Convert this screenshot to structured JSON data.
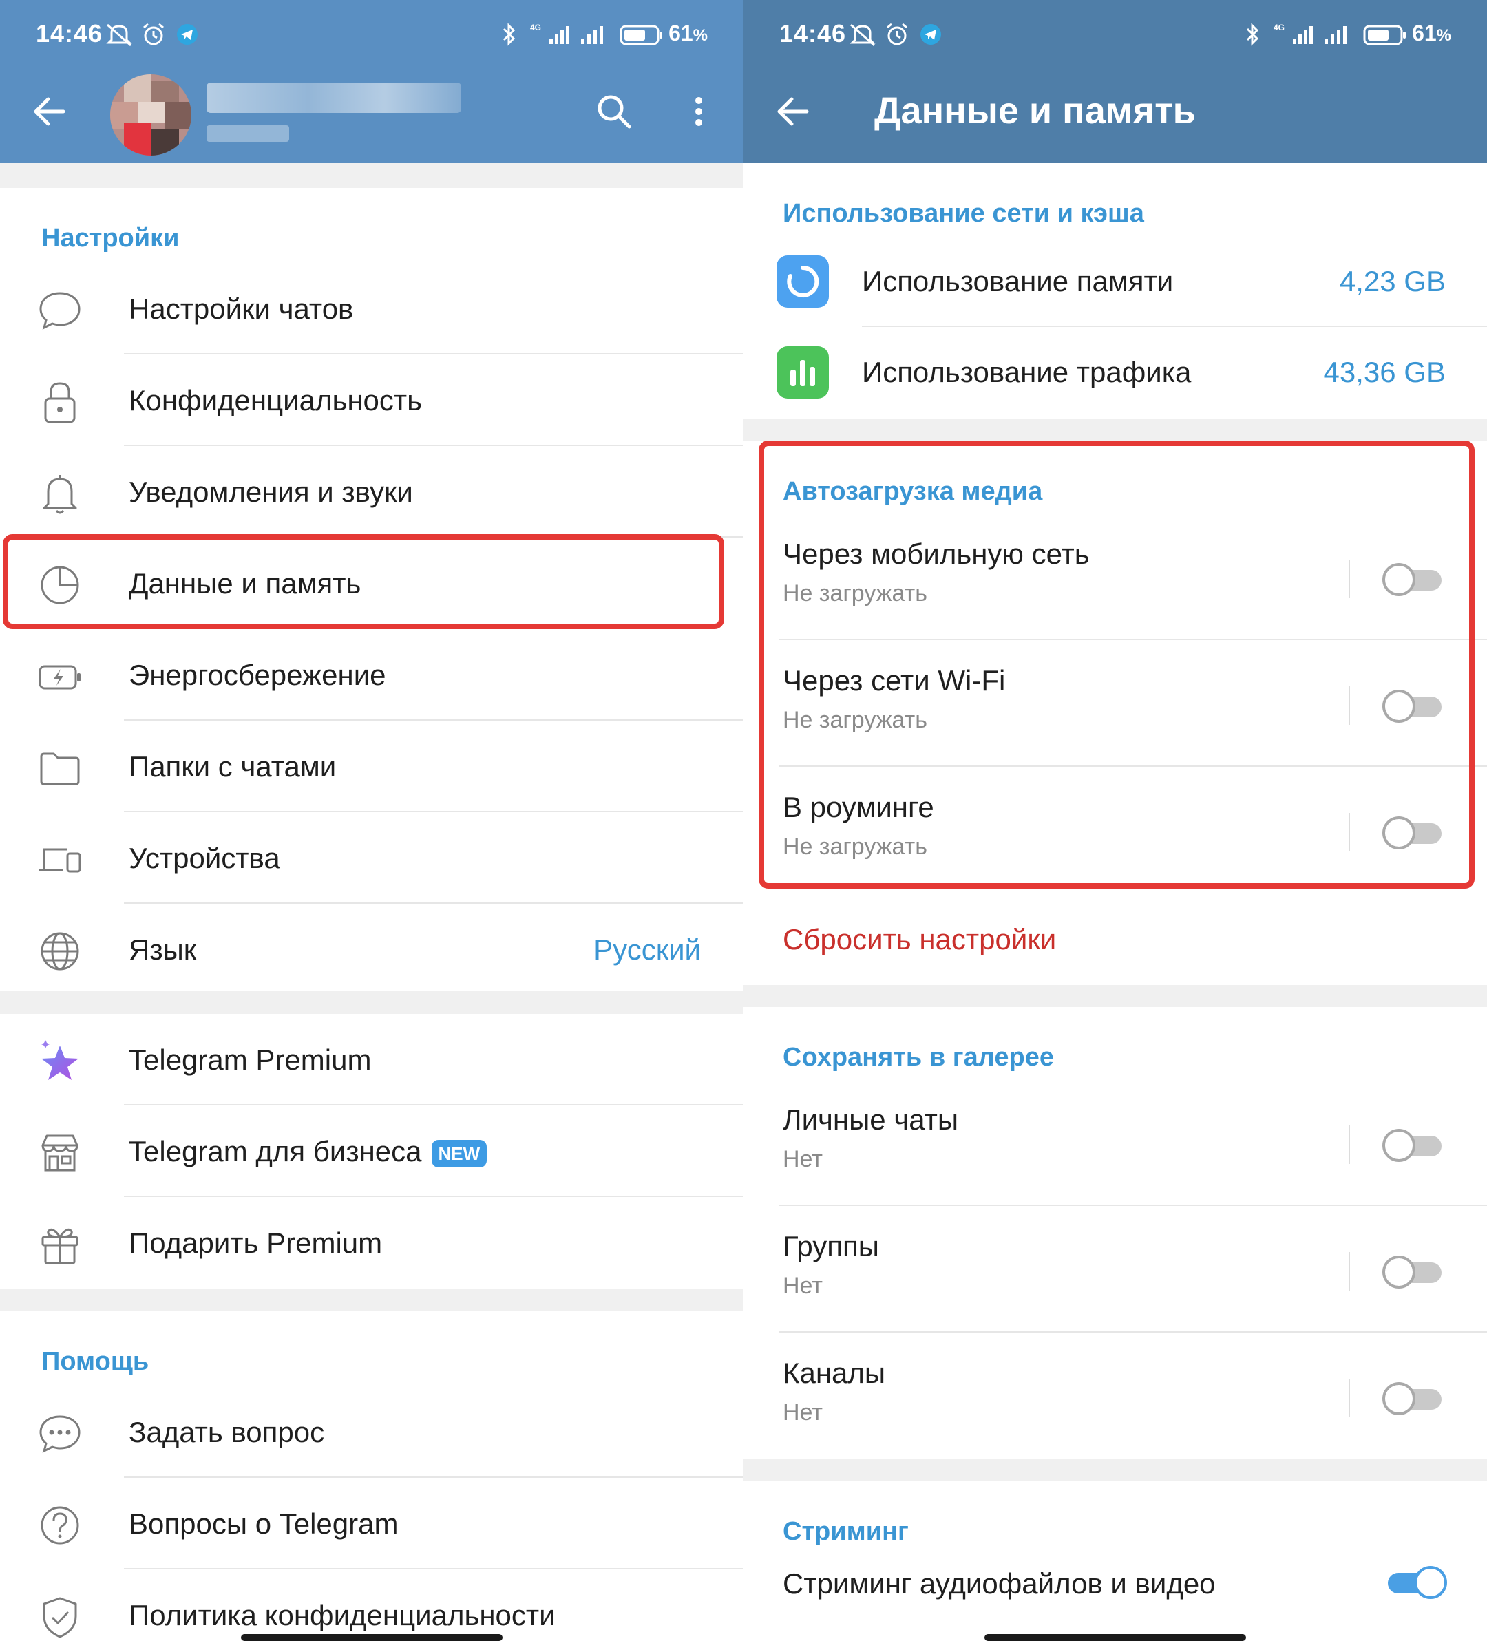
{
  "status_bar": {
    "time": "14:46",
    "network": "4G",
    "battery_percent": "61",
    "battery_suffix": "%"
  },
  "left": {
    "header": {
      "back_icon": "arrow-left-icon",
      "search_icon": "search-icon",
      "more_icon": "more-vertical-icon"
    },
    "settings_section": {
      "title": "Настройки",
      "items": [
        {
          "label": "Настройки чатов",
          "icon": "chat-bubble-icon"
        },
        {
          "label": "Конфиденциальность",
          "icon": "lock-icon"
        },
        {
          "label": "Уведомления и звуки",
          "icon": "bell-icon"
        },
        {
          "label": "Данные и память",
          "icon": "pie-chart-icon",
          "highlighted": true
        },
        {
          "label": "Энергосбережение",
          "icon": "battery-bolt-icon"
        },
        {
          "label": "Папки с чатами",
          "icon": "folder-icon"
        },
        {
          "label": "Устройства",
          "icon": "devices-icon"
        },
        {
          "label": "Язык",
          "icon": "globe-icon",
          "value": "Русский"
        }
      ]
    },
    "premium_section": {
      "items": [
        {
          "label": "Telegram Premium",
          "icon": "premium-star-icon"
        },
        {
          "label": "Telegram для бизнеса",
          "icon": "store-icon",
          "badge": "NEW"
        },
        {
          "label": "Подарить Premium",
          "icon": "gift-icon"
        }
      ]
    },
    "help_section": {
      "title": "Помощь",
      "items": [
        {
          "label": "Задать вопрос",
          "icon": "chat-dots-icon"
        },
        {
          "label": "Вопросы о Telegram",
          "icon": "question-circle-icon"
        },
        {
          "label": "Политика конфиденциальности",
          "icon": "shield-check-icon"
        }
      ]
    }
  },
  "right": {
    "header": {
      "title": "Данные и память",
      "back_icon": "arrow-left-icon"
    },
    "network_section": {
      "title": "Использование сети и кэша",
      "items": [
        {
          "label": "Использование памяти",
          "value": "4,23 GB",
          "icon": "storage-ring-icon",
          "color": "#4da2f0"
        },
        {
          "label": "Использование трафика",
          "value": "43,36 GB",
          "icon": "bar-chart-icon",
          "color": "#4cc35a"
        }
      ]
    },
    "autodownload_section": {
      "title": "Автозагрузка медиа",
      "items": [
        {
          "label": "Через мобильную сеть",
          "sub": "Не загружать",
          "enabled": false
        },
        {
          "label": "Через сети Wi-Fi",
          "sub": "Не загружать",
          "enabled": false
        },
        {
          "label": "В роуминге",
          "sub": "Не загружать",
          "enabled": false
        }
      ],
      "reset_label": "Сбросить настройки"
    },
    "gallery_section": {
      "title": "Сохранять в галерее",
      "items": [
        {
          "label": "Личные чаты",
          "sub": "Нет",
          "enabled": false
        },
        {
          "label": "Группы",
          "sub": "Нет",
          "enabled": false
        },
        {
          "label": "Каналы",
          "sub": "Нет",
          "enabled": false
        }
      ]
    },
    "streaming_section": {
      "title": "Стриминг",
      "items": [
        {
          "label": "Стриминг аудиофайлов и видео",
          "enabled": true
        }
      ]
    }
  },
  "colors": {
    "header_left": "#5a8fc2",
    "header_right": "#4f7ea8",
    "accent": "#3a95d3",
    "highlight": "#e53935",
    "destructive": "#c9302c"
  }
}
